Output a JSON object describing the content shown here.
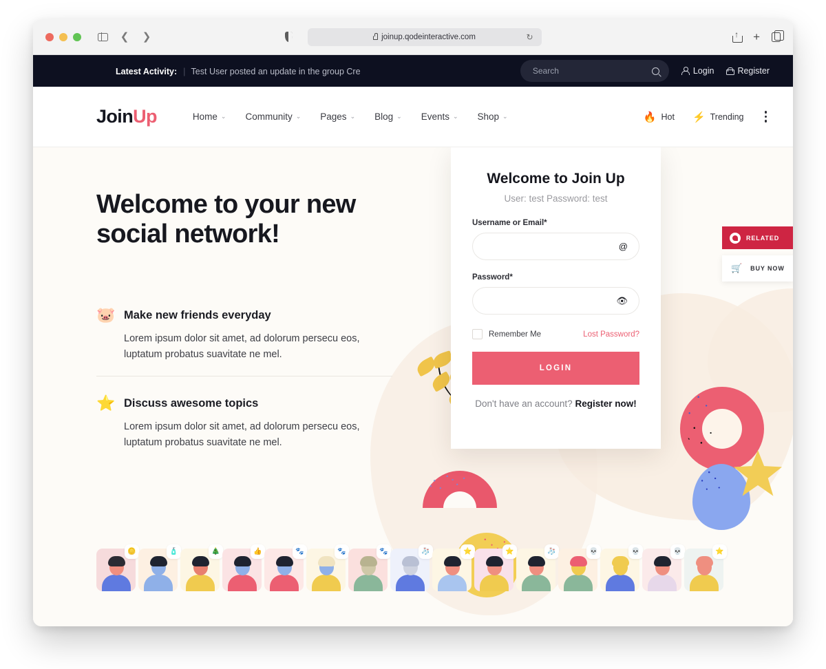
{
  "browser": {
    "url": "joinup.qodeinteractive.com",
    "lock_icon": "lock-icon",
    "reload_icon": "reload-icon",
    "share_icon": "share-icon",
    "newtab_icon": "plus-icon",
    "tabs_icon": "tab-overview-icon",
    "sidebar_icon": "sidebar-toggle-icon",
    "back_icon": "back-chevron-icon",
    "forward_icon": "forward-chevron-icon",
    "shield_icon": "privacy-shield-icon"
  },
  "topbar": {
    "activity_label": "Latest Activity:",
    "separator": "|",
    "activity_text": "Test User posted an update in the group Cre",
    "search": {
      "value": "",
      "placeholder": "Search",
      "icon": "search-icon"
    },
    "login": {
      "label": "Login",
      "icon": "user-icon"
    },
    "register": {
      "label": "Register",
      "icon": "lock-icon"
    }
  },
  "nav": {
    "logo": {
      "part1": "Join",
      "part2": "Up"
    },
    "items": [
      {
        "label": "Home",
        "caret": "⌄"
      },
      {
        "label": "Community",
        "caret": "⌄"
      },
      {
        "label": "Pages",
        "caret": "⌄"
      },
      {
        "label": "Blog",
        "caret": "⌄"
      },
      {
        "label": "Events",
        "caret": "⌄"
      },
      {
        "label": "Shop",
        "caret": "⌄"
      }
    ],
    "hot": {
      "label": "Hot",
      "icon": "🔥"
    },
    "trending": {
      "label": "Trending",
      "icon": "⚡"
    },
    "more_icon": "kebab-menu-icon"
  },
  "hero": {
    "title_line1": "Welcome to your new",
    "title_line2": "social network!",
    "features": [
      {
        "icon": "🐷",
        "title": "Make new friends everyday",
        "desc": "Lorem ipsum dolor sit amet, ad dolorum persecu eos, luptatum probatus suavitate ne mel."
      },
      {
        "icon": "⭐",
        "title": "Discuss awesome topics",
        "desc": "Lorem ipsum dolor sit amet, ad dolorum persecu eos, luptatum probatus suavitate ne mel."
      }
    ]
  },
  "login_card": {
    "title": "Welcome to Join Up",
    "subtitle": "User: test Password: test",
    "username": {
      "label": "Username or Email*",
      "value": "",
      "placeholder": "",
      "icon": "@"
    },
    "password": {
      "label": "Password*",
      "value": "",
      "placeholder": "",
      "icon": "👁"
    },
    "remember": {
      "label": "Remember Me",
      "checked": false
    },
    "lost_password": "Lost Password?",
    "submit": "LOGIN",
    "signup_prefix": "Don't have an account? ",
    "signup_link": "Register now!"
  },
  "side_buttons": {
    "related": {
      "label": "RELATED",
      "icon": "qode-logo-icon"
    },
    "buy_now": {
      "label": "BUY NOW",
      "icon": "🛒"
    }
  },
  "colors": {
    "accent_pink": "#ec5f72",
    "dark_bar": "#0d1020",
    "hero_bg": "#fdfbf7",
    "related_red": "#ce2543",
    "yellow": "#f2cd56",
    "blue": "#8aa7ef"
  },
  "avatars": [
    {
      "badge": "🪙",
      "bg": "#f6dbdc",
      "skin": "#ef8f80",
      "hair": "#2b2b33",
      "shirt": "#5f7ae0"
    },
    {
      "badge": "🧴",
      "bg": "#fdf0e2",
      "skin": "#8fb0e8",
      "hair": "#1f2330",
      "shirt": "#8fb0e8"
    },
    {
      "badge": "🎄",
      "bg": "#fdf6e4",
      "skin": "#e8806f",
      "hair": "#1f2330",
      "shirt": "#f0cb4f"
    },
    {
      "badge": "👍",
      "bg": "#fbe3e4",
      "skin": "#8fb0e8",
      "hair": "#1f2330",
      "shirt": "#ec5f72"
    },
    {
      "badge": "🐾",
      "bg": "#fde8e6",
      "skin": "#8fb0e8",
      "hair": "#1f2330",
      "shirt": "#ec5f72"
    },
    {
      "badge": "🐾",
      "bg": "#fdf6e4",
      "skin": "#8fb0e8",
      "hair": "#f0e3c0",
      "shirt": "#f0cb4f"
    },
    {
      "badge": "🐾",
      "bg": "#fbe0de",
      "skin": "#cfc8a8",
      "hair": "#b8b390",
      "shirt": "#8ab79a"
    },
    {
      "badge": "🧦",
      "bg": "#eef1fb",
      "skin": "#cfd3e0",
      "hair": "#b9c0d4",
      "shirt": "#5f7ae0"
    },
    {
      "badge": "⭐",
      "bg": "#fdf6e4",
      "skin": "#ef8f80",
      "hair": "#1f2330",
      "shirt": "#a9c5ef"
    },
    {
      "badge": "⭐",
      "bg": "#f9e1ea",
      "skin": "#ef8f80",
      "hair": "#1f2330",
      "shirt": "#f0cb4f"
    },
    {
      "badge": "🧦",
      "bg": "#fdf6e4",
      "skin": "#ef8f80",
      "hair": "#1f2330",
      "shirt": "#8ab79a"
    },
    {
      "badge": "💀",
      "bg": "#fdf0e2",
      "skin": "#f0cb4f",
      "hair": "#ec5f72",
      "shirt": "#8ab79a"
    },
    {
      "badge": "💀",
      "bg": "#fdf6e4",
      "skin": "#f0cb4f",
      "hair": "#f0cb4f",
      "shirt": "#5f7ae0"
    },
    {
      "badge": "💀",
      "bg": "#fbeaea",
      "skin": "#ef8f80",
      "hair": "#1f2330",
      "shirt": "#e7d8ea"
    },
    {
      "badge": "⭐",
      "bg": "#eef3f1",
      "skin": "#ef8f80",
      "hair": "#ef8f80",
      "shirt": "#f0cb4f"
    }
  ]
}
